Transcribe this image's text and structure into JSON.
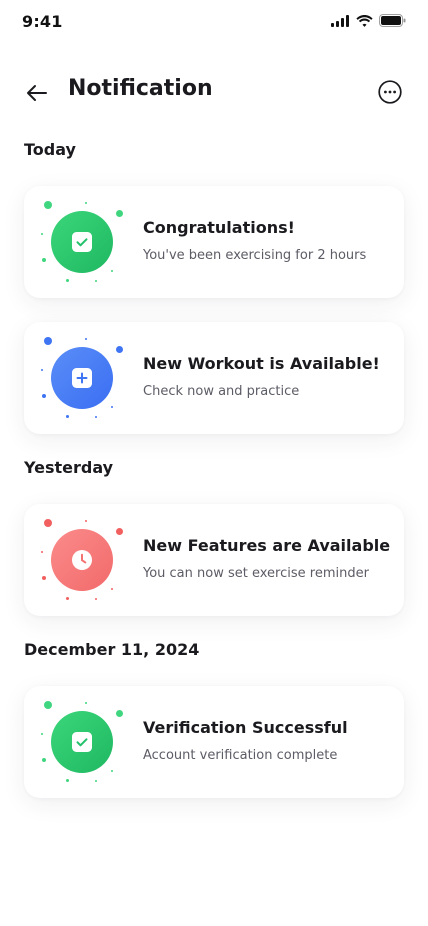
{
  "status_bar": {
    "time": "9:41"
  },
  "header": {
    "title": "Notification"
  },
  "colors": {
    "green": "#22c16a",
    "blue": "#3f74f3",
    "red": "#f47272"
  },
  "sections": [
    {
      "title": "Today",
      "items": [
        {
          "title": "Congratulations!",
          "description": "You've been exercising for 2 hours",
          "icon": "check-icon",
          "color": "green"
        },
        {
          "title": "New Workout is Available!",
          "description": "Check now and practice",
          "icon": "plus-icon",
          "color": "blue"
        }
      ]
    },
    {
      "title": "Yesterday",
      "items": [
        {
          "title": "New Features are Available",
          "description": "You can now set exercise reminder",
          "icon": "clock-icon",
          "color": "red"
        }
      ]
    },
    {
      "title": "December 11, 2024",
      "items": [
        {
          "title": "Verification Successful",
          "description": "Account verification complete",
          "icon": "check-icon",
          "color": "green"
        }
      ]
    }
  ]
}
